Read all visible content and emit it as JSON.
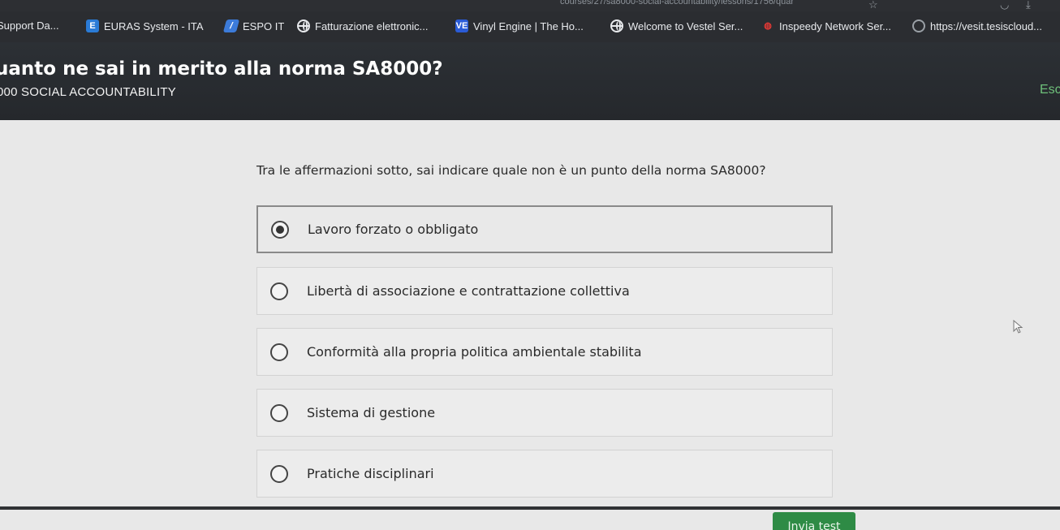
{
  "browser": {
    "url_fragment": "courses/27/sa8000-social-accountability/lessons/1756/quar"
  },
  "bookmarks": [
    {
      "label": "Support Da...",
      "icon": "none"
    },
    {
      "label": "EURAS System - ITA",
      "icon": "euras-icon"
    },
    {
      "label": "ESPO IT",
      "icon": "espo-icon"
    },
    {
      "label": "Fatturazione elettronic...",
      "icon": "globe-icon"
    },
    {
      "label": "Vinyl Engine | The Ho...",
      "icon": "vinyl-icon"
    },
    {
      "label": "Welcome to Vestel Ser...",
      "icon": "globe-icon"
    },
    {
      "label": "Inspeedy Network Ser...",
      "icon": "inspeedy-icon"
    },
    {
      "label": "https://vesit.tesiscloud...",
      "icon": "circle-icon"
    }
  ],
  "header": {
    "title": "uanto ne sai in merito alla norma SA8000?",
    "course": "000 SOCIAL ACCOUNTABILITY",
    "esc": "Esc"
  },
  "quiz": {
    "question": "Tra le affermazioni sotto, sai indicare quale non è un punto della norma SA8000?",
    "options": [
      {
        "label": "Lavoro forzato o obbligato",
        "selected": true
      },
      {
        "label": "Libertà di associazione e contrattazione collettiva",
        "selected": false
      },
      {
        "label": "Conformità alla propria politica ambientale stabilita",
        "selected": false
      },
      {
        "label": "Sistema di gestione",
        "selected": false
      },
      {
        "label": "Pratiche disciplinari",
        "selected": false
      }
    ],
    "submit_label": "Invia test"
  },
  "colors": {
    "header_bg": "#2c3035",
    "accent_green": "#2e8b45",
    "esc_green": "#6ec07a"
  }
}
